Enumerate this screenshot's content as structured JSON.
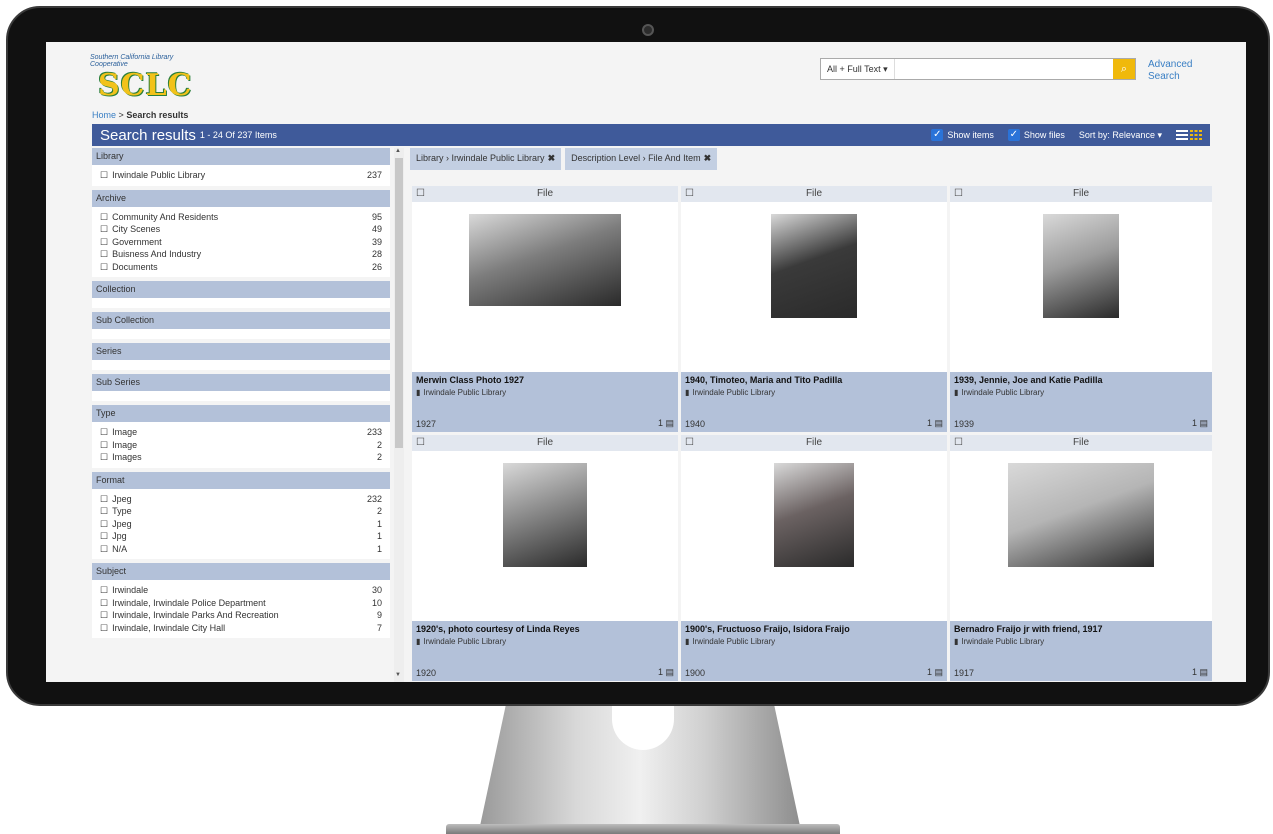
{
  "header": {
    "logo_text": "SCLC",
    "logo_arc": "Southern California Library Cooperative",
    "search_scope": "All + Full Text ▾",
    "search_placeholder": "",
    "search_icon": "search-icon",
    "advanced_search": "Advanced Search"
  },
  "breadcrumb": {
    "home": "Home",
    "sep": ">",
    "current": "Search results"
  },
  "results_bar": {
    "title": "Search results",
    "count": "1 - 24 Of 237 Items",
    "show_items": "Show items",
    "show_files": "Show files",
    "sort": "Sort by: Relevance",
    "sort_caret": "▾"
  },
  "facets": [
    {
      "name": "Library",
      "items": [
        {
          "label": "Irwindale Public Library",
          "count": "237"
        }
      ]
    },
    {
      "name": "Archive",
      "items": [
        {
          "label": "Community And Residents",
          "count": "95"
        },
        {
          "label": "City Scenes",
          "count": "49"
        },
        {
          "label": "Government",
          "count": "39"
        },
        {
          "label": "Buisness And Industry",
          "count": "28"
        },
        {
          "label": "Documents",
          "count": "26"
        }
      ]
    },
    {
      "name": "Collection",
      "items": []
    },
    {
      "name": "Sub Collection",
      "items": []
    },
    {
      "name": "Series",
      "items": []
    },
    {
      "name": "Sub Series",
      "items": []
    },
    {
      "name": "Type",
      "items": [
        {
          "label": "Image",
          "count": "233"
        },
        {
          "label": "Image",
          "count": "2"
        },
        {
          "label": "Images",
          "count": "2"
        }
      ]
    },
    {
      "name": "Format",
      "items": [
        {
          "label": "Jpeg",
          "count": "232"
        },
        {
          "label": "Type",
          "count": "2"
        },
        {
          "label": "Jpeg",
          "count": "1"
        },
        {
          "label": "Jpg",
          "count": "1"
        },
        {
          "label": "N/A",
          "count": "1"
        }
      ]
    },
    {
      "name": "Subject",
      "items": [
        {
          "label": "Irwindale",
          "count": "30"
        },
        {
          "label": "Irwindale, Irwindale Police Department",
          "count": "10"
        },
        {
          "label": "Irwindale, Irwindale Parks And Recreation",
          "count": "9"
        },
        {
          "label": "Irwindale, Irwindale City Hall",
          "count": "7"
        }
      ]
    }
  ],
  "filters": [
    {
      "label": "Library › Irwindale Public Library",
      "remove": "✖"
    },
    {
      "label": "Description Level › File And Item",
      "remove": "✖"
    }
  ],
  "cards": [
    {
      "type": "File",
      "title": "Merwin Class Photo 1927",
      "library": "Irwindale Public Library",
      "year": "1927",
      "files": "1",
      "photo_color": "#7d7d7d"
    },
    {
      "type": "File",
      "title": "1940, Timoteo, Maria and Tito Padilla",
      "library": "Irwindale Public Library",
      "year": "1940",
      "files": "1",
      "photo_color": "#3a3a3a"
    },
    {
      "type": "File",
      "title": "1939, Jennie, Joe and Katie Padilla",
      "library": "Irwindale Public Library",
      "year": "1939",
      "files": "1",
      "photo_color": "#9c9c9c"
    },
    {
      "type": "File",
      "title": "1920's, photo courtesy of Linda Reyes",
      "library": "Irwindale Public Library",
      "year": "1920",
      "files": "1",
      "photo_color": "#8a8a8a"
    },
    {
      "type": "File",
      "title": "1900's, Fructuoso Fraijo, Isidora Fraijo",
      "library": "Irwindale Public Library",
      "year": "1900",
      "files": "1",
      "photo_color": "#6b6262"
    },
    {
      "type": "File",
      "title": "Bernadro Fraijo jr with friend, 1917",
      "library": "Irwindale Public Library",
      "year": "1917",
      "files": "1",
      "photo_color": "#b5b5b5"
    }
  ],
  "colors": {
    "bar": "#3f5a9a",
    "facet_head": "#b3c1d9",
    "accent": "#f0b90b",
    "link": "#3a7fc4"
  }
}
